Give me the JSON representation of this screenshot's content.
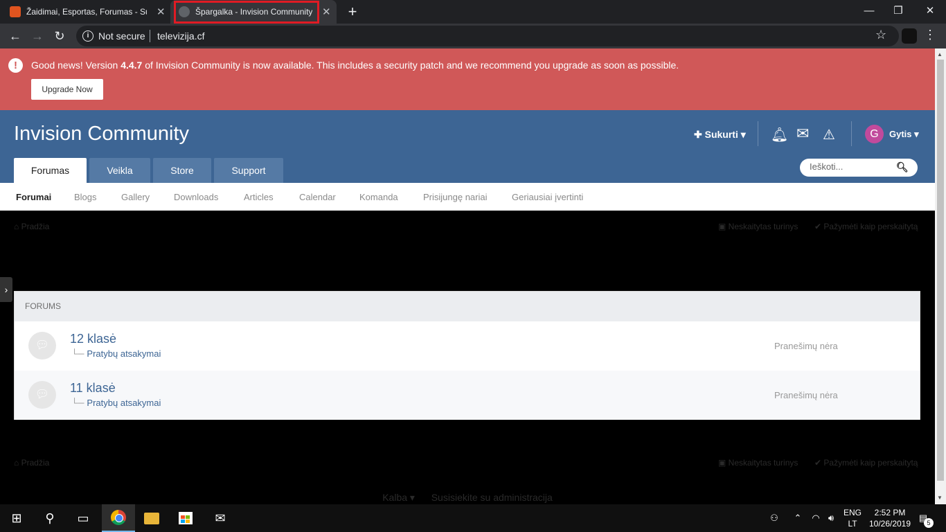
{
  "browser": {
    "tabs": [
      {
        "title": "Žaidimai, Esportas, Forumas - Su"
      },
      {
        "title": "Špargalka - Invision Community"
      }
    ],
    "close_glyph": "✕",
    "new_tab_glyph": "+",
    "window_controls": {
      "minimize": "—",
      "maximize": "❐",
      "close": "✕"
    },
    "nav": {
      "back": "←",
      "forward": "→",
      "reload": "↻"
    },
    "security_label": "Not secure",
    "url": "televizija.cf",
    "icons": [
      "info-icon",
      "star-icon",
      "extension-icon",
      "menu-icon"
    ]
  },
  "banner": {
    "text_before": "Good news! Version ",
    "version": "4.4.7",
    "text_after": " of Invision Community is now available. This includes a security patch and we recommend you upgrade as soon as possible.",
    "button_label": "Upgrade Now",
    "color": "#d05858"
  },
  "header": {
    "site_title": "Invision Community",
    "create_label": "Sukurti",
    "user_initial": "G",
    "user_name": "Gytis",
    "color": "#3d6594",
    "main_tabs": [
      {
        "label": "Forumas"
      },
      {
        "label": "Veikla"
      },
      {
        "label": "Store"
      },
      {
        "label": "Support"
      }
    ],
    "search_placeholder": "Ieškoti..."
  },
  "subnav": {
    "items": [
      {
        "label": "Forumai"
      },
      {
        "label": "Blogs"
      },
      {
        "label": "Gallery"
      },
      {
        "label": "Downloads"
      },
      {
        "label": "Articles"
      },
      {
        "label": "Calendar"
      },
      {
        "label": "Komanda"
      },
      {
        "label": "Prisijungę nariai"
      },
      {
        "label": "Geriausiai įvertinti"
      }
    ]
  },
  "breadcrumb": {
    "home_label": "Pradžia",
    "unread_label": "Neskaitytas turinys",
    "mark_read_label": "Pažymėti kaip perskaitytą"
  },
  "forums": {
    "header": "FORUMS",
    "rows": [
      {
        "title": "12 klasė",
        "subforum": "Pratybų atsakymai",
        "last_post": "Pranešimų nėra"
      },
      {
        "title": "11 klasė",
        "subforum": "Pratybų atsakymai",
        "last_post": "Pranešimų nėra"
      }
    ]
  },
  "footer": {
    "language_label": "Kalba",
    "contact_label": "Susisiekite su administracija"
  },
  "taskbar": {
    "language": {
      "code": "ENG",
      "layout": "LT"
    },
    "time": "2:52 PM",
    "date": "10/26/2019",
    "notification_count": "5"
  }
}
